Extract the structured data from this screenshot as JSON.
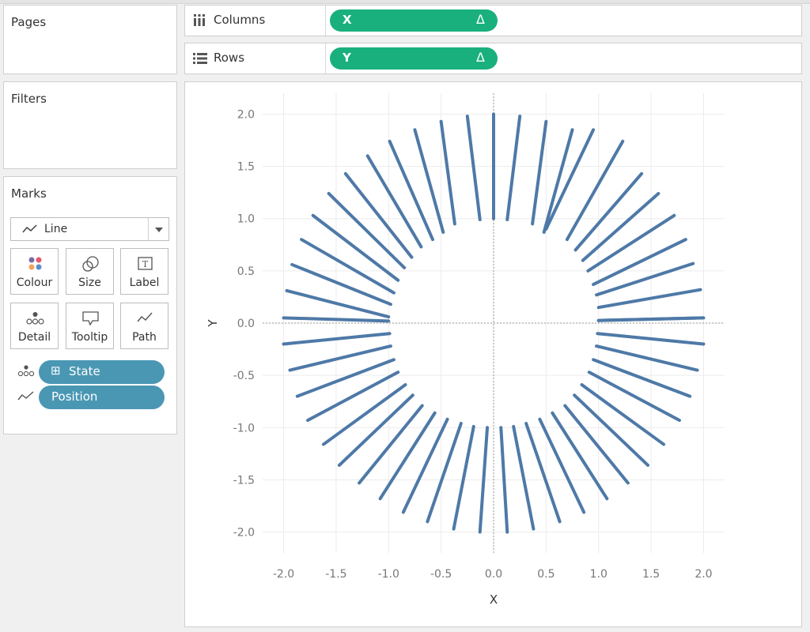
{
  "panels": {
    "pages_title": "Pages",
    "filters_title": "Filters",
    "marks_title": "Marks"
  },
  "shelves": {
    "columns": {
      "label": "Columns",
      "icon": "columns-icon",
      "pill": "X",
      "pill_suffix": "Δ"
    },
    "rows": {
      "label": "Rows",
      "icon": "rows-icon",
      "pill": "Y",
      "pill_suffix": "Δ"
    }
  },
  "marks": {
    "type": "Line",
    "buttons": [
      {
        "label": "Colour",
        "icon": "colour-icon"
      },
      {
        "label": "Size",
        "icon": "size-icon"
      },
      {
        "label": "Label",
        "icon": "label-icon"
      },
      {
        "label": "Detail",
        "icon": "detail-icon"
      },
      {
        "label": "Tooltip",
        "icon": "tooltip-icon"
      },
      {
        "label": "Path",
        "icon": "path-icon"
      }
    ],
    "fields": [
      {
        "name": "State",
        "icon": "detail-icon",
        "prefix": "⊞"
      },
      {
        "name": "Position",
        "icon": "path-icon"
      }
    ]
  },
  "colors": {
    "accent_green": "#19b07e",
    "accent_blue": "#4a97b4",
    "line_color": "#4e79a7"
  },
  "chart_data": {
    "type": "line",
    "xlabel": "X",
    "ylabel": "Y",
    "xlim": [
      -2.2,
      2.2
    ],
    "ylim": [
      -2.2,
      2.2
    ],
    "xticks": [
      "-2.0",
      "-1.5",
      "-1.0",
      "-0.5",
      "0.0",
      "0.5",
      "1.0",
      "1.5",
      "2.0"
    ],
    "yticks": [
      "2.0",
      "1.5",
      "1.0",
      "0.5",
      "0.0",
      "-0.5",
      "-1.0",
      "-1.5",
      "-2.0"
    ],
    "grid": true,
    "reference_lines": {
      "x": 0,
      "y": 0
    },
    "series_count": 50,
    "series": [
      {
        "from": [
          2.0,
          0.05
        ],
        "to": [
          1.0,
          0.025
        ]
      },
      {
        "from": [
          1.97,
          0.32
        ],
        "to": [
          1.0,
          0.15
        ]
      },
      {
        "from": [
          1.9,
          0.57
        ],
        "to": [
          0.98,
          0.27
        ]
      },
      {
        "from": [
          1.83,
          0.8
        ],
        "to": [
          0.95,
          0.37
        ]
      },
      {
        "from": [
          1.72,
          1.03
        ],
        "to": [
          0.9,
          0.5
        ]
      },
      {
        "from": [
          1.57,
          1.24
        ],
        "to": [
          0.85,
          0.6
        ]
      },
      {
        "from": [
          1.41,
          1.43
        ],
        "to": [
          0.78,
          0.7
        ]
      },
      {
        "from": [
          1.23,
          1.74
        ],
        "to": [
          0.7,
          0.8
        ]
      },
      {
        "from": [
          0.95,
          1.85
        ],
        "to": [
          0.5,
          0.9
        ]
      },
      {
        "from": [
          0.75,
          1.85
        ],
        "to": [
          0.48,
          0.87
        ]
      },
      {
        "from": [
          0.5,
          1.93
        ],
        "to": [
          0.37,
          0.95
        ]
      },
      {
        "from": [
          0.25,
          1.98
        ],
        "to": [
          0.13,
          0.99
        ]
      },
      {
        "from": [
          0.0,
          2.0
        ],
        "to": [
          0.0,
          1.0
        ]
      },
      {
        "from": [
          -0.25,
          1.98
        ],
        "to": [
          -0.13,
          0.99
        ]
      },
      {
        "from": [
          -0.5,
          1.93
        ],
        "to": [
          -0.37,
          0.95
        ]
      },
      {
        "from": [
          -0.75,
          1.85
        ],
        "to": [
          -0.48,
          0.87
        ]
      },
      {
        "from": [
          -0.99,
          1.74
        ],
        "to": [
          -0.58,
          0.8
        ]
      },
      {
        "from": [
          -1.2,
          1.6
        ],
        "to": [
          -0.69,
          0.73
        ]
      },
      {
        "from": [
          -1.41,
          1.43
        ],
        "to": [
          -0.78,
          0.63
        ]
      },
      {
        "from": [
          -1.57,
          1.24
        ],
        "to": [
          -0.85,
          0.53
        ]
      },
      {
        "from": [
          -1.72,
          1.03
        ],
        "to": [
          -0.91,
          0.41
        ]
      },
      {
        "from": [
          -1.83,
          0.8
        ],
        "to": [
          -0.95,
          0.29
        ]
      },
      {
        "from": [
          -1.92,
          0.56
        ],
        "to": [
          -0.98,
          0.18
        ]
      },
      {
        "from": [
          -1.97,
          0.31
        ],
        "to": [
          -1.0,
          0.06
        ]
      },
      {
        "from": [
          -2.0,
          0.05
        ],
        "to": [
          -1.0,
          0.02
        ]
      },
      {
        "from": [
          -2.0,
          -0.2
        ],
        "to": [
          -0.99,
          -0.1
        ]
      },
      {
        "from": [
          -1.94,
          -0.45
        ],
        "to": [
          -0.98,
          -0.22
        ]
      },
      {
        "from": [
          -1.87,
          -0.7
        ],
        "to": [
          -0.95,
          -0.35
        ]
      },
      {
        "from": [
          -1.77,
          -0.93
        ],
        "to": [
          -0.91,
          -0.47
        ]
      },
      {
        "from": [
          -1.62,
          -1.16
        ],
        "to": [
          -0.84,
          -0.59
        ]
      },
      {
        "from": [
          -1.47,
          -1.36
        ],
        "to": [
          -0.77,
          -0.69
        ]
      },
      {
        "from": [
          -1.28,
          -1.53
        ],
        "to": [
          -0.68,
          -0.79
        ]
      },
      {
        "from": [
          -1.08,
          -1.68
        ],
        "to": [
          -0.56,
          -0.86
        ]
      },
      {
        "from": [
          -0.86,
          -1.81
        ],
        "to": [
          -0.44,
          -0.92
        ]
      },
      {
        "from": [
          -0.63,
          -1.9
        ],
        "to": [
          -0.31,
          -0.96
        ]
      },
      {
        "from": [
          -0.38,
          -1.97
        ],
        "to": [
          -0.19,
          -0.99
        ]
      },
      {
        "from": [
          -0.13,
          -2.0
        ],
        "to": [
          -0.06,
          -1.0
        ]
      },
      {
        "from": [
          0.13,
          -2.0
        ],
        "to": [
          0.07,
          -1.0
        ]
      },
      {
        "from": [
          0.38,
          -1.97
        ],
        "to": [
          0.19,
          -0.99
        ]
      },
      {
        "from": [
          0.63,
          -1.9
        ],
        "to": [
          0.31,
          -0.96
        ]
      },
      {
        "from": [
          0.86,
          -1.81
        ],
        "to": [
          0.44,
          -0.92
        ]
      },
      {
        "from": [
          1.08,
          -1.68
        ],
        "to": [
          0.56,
          -0.86
        ]
      },
      {
        "from": [
          1.28,
          -1.53
        ],
        "to": [
          0.68,
          -0.79
        ]
      },
      {
        "from": [
          1.47,
          -1.36
        ],
        "to": [
          0.77,
          -0.69
        ]
      },
      {
        "from": [
          1.62,
          -1.16
        ],
        "to": [
          0.84,
          -0.59
        ]
      },
      {
        "from": [
          1.77,
          -0.93
        ],
        "to": [
          0.91,
          -0.47
        ]
      },
      {
        "from": [
          1.87,
          -0.7
        ],
        "to": [
          0.95,
          -0.35
        ]
      },
      {
        "from": [
          1.94,
          -0.45
        ],
        "to": [
          0.98,
          -0.22
        ]
      },
      {
        "from": [
          2.0,
          -0.2
        ],
        "to": [
          0.99,
          -0.1
        ]
      },
      {
        "from": [
          1.99,
          0.05
        ],
        "to": [
          1.0,
          0.025
        ]
      }
    ]
  }
}
